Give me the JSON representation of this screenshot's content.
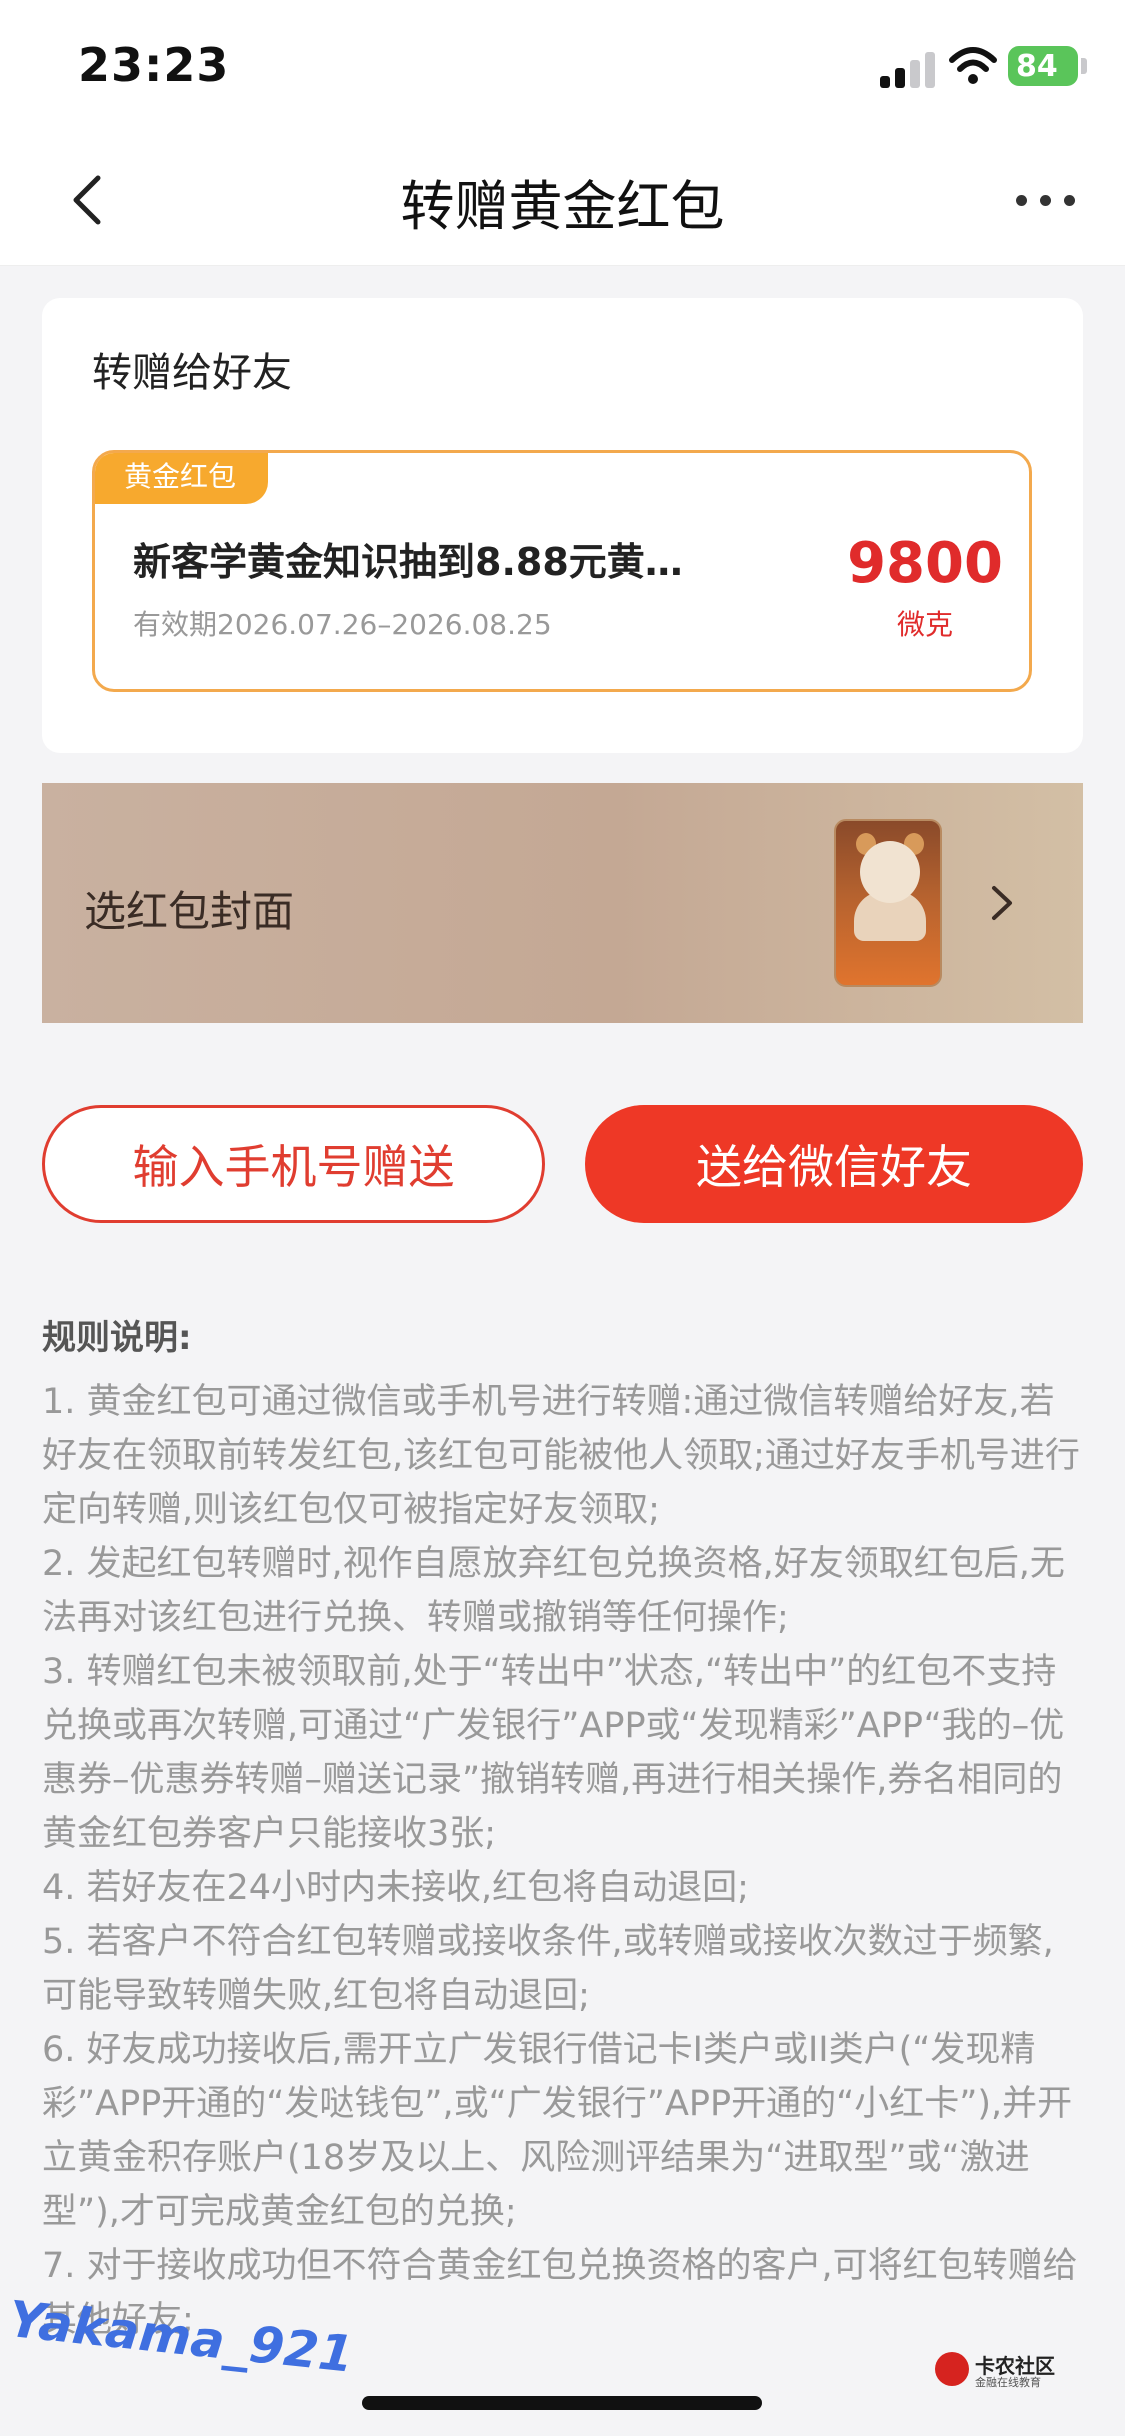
{
  "status_bar": {
    "time": "23:23",
    "battery": "84"
  },
  "nav": {
    "title": "转赠黄金红包"
  },
  "gift_card": {
    "title": "转赠给好友",
    "coupon": {
      "tag": "黄金红包",
      "name": "新客学黄金知识抽到8.88元黄…",
      "validity": "有效期2026.07.26–2026.08.25",
      "amount": "9800",
      "unit": "微克"
    }
  },
  "cover": {
    "label": "选红包封面"
  },
  "actions": {
    "phone_label": "输入手机号赠送",
    "wechat_label": "送给微信好友"
  },
  "rules": {
    "title": "规则说明:",
    "items": [
      "1. 黄金红包可通过微信或手机号进行转赠:通过微信转赠给好友,若好友在领取前转发红包,该红包可能被他人领取;通过好友手机号进行定向转赠,则该红包仅可被指定好友领取;",
      "2. 发起红包转赠时,视作自愿放弃红包兑换资格,好友领取红包后,无法再对该红包进行兑换、转赠或撤销等任何操作;",
      "3. 转赠红包未被领取前,处于“转出中”状态,“转出中”的红包不支持兑换或再次转赠,可通过“广发银行”APP或“发现精彩”APP“我的–优惠券–优惠券转赠–赠送记录”撤销转赠,再进行相关操作,券名相同的黄金红包券客户只能接收3张;",
      "4. 若好友在24小时内未接收,红包将自动退回;",
      "5. 若客户不符合红包转赠或接收条件,或转赠或接收次数过于频繁,可能导致转赠失败,红包将自动退回;",
      "6. 好友成功接收后,需开立广发银行借记卡I类户或II类户(“发现精彩”APP开通的“发哒钱包”,或“广发银行”APP开通的“小红卡”),并开立黄金积存账户(18岁及以上、风险测评结果为“进取型”或“激进型”),才可完成黄金红包的兑换;",
      "7. 对于接收成功但不符合黄金红包兑换资格的客户,可将红包转赠给其他好友;"
    ]
  },
  "watermark": "Yakama_921",
  "logo": {
    "name": "卡农社区",
    "sub": "金融在线教育"
  },
  "colors": {
    "accent": "#ee3826",
    "gold": "#f7a92e",
    "amount": "#e02b2b"
  }
}
